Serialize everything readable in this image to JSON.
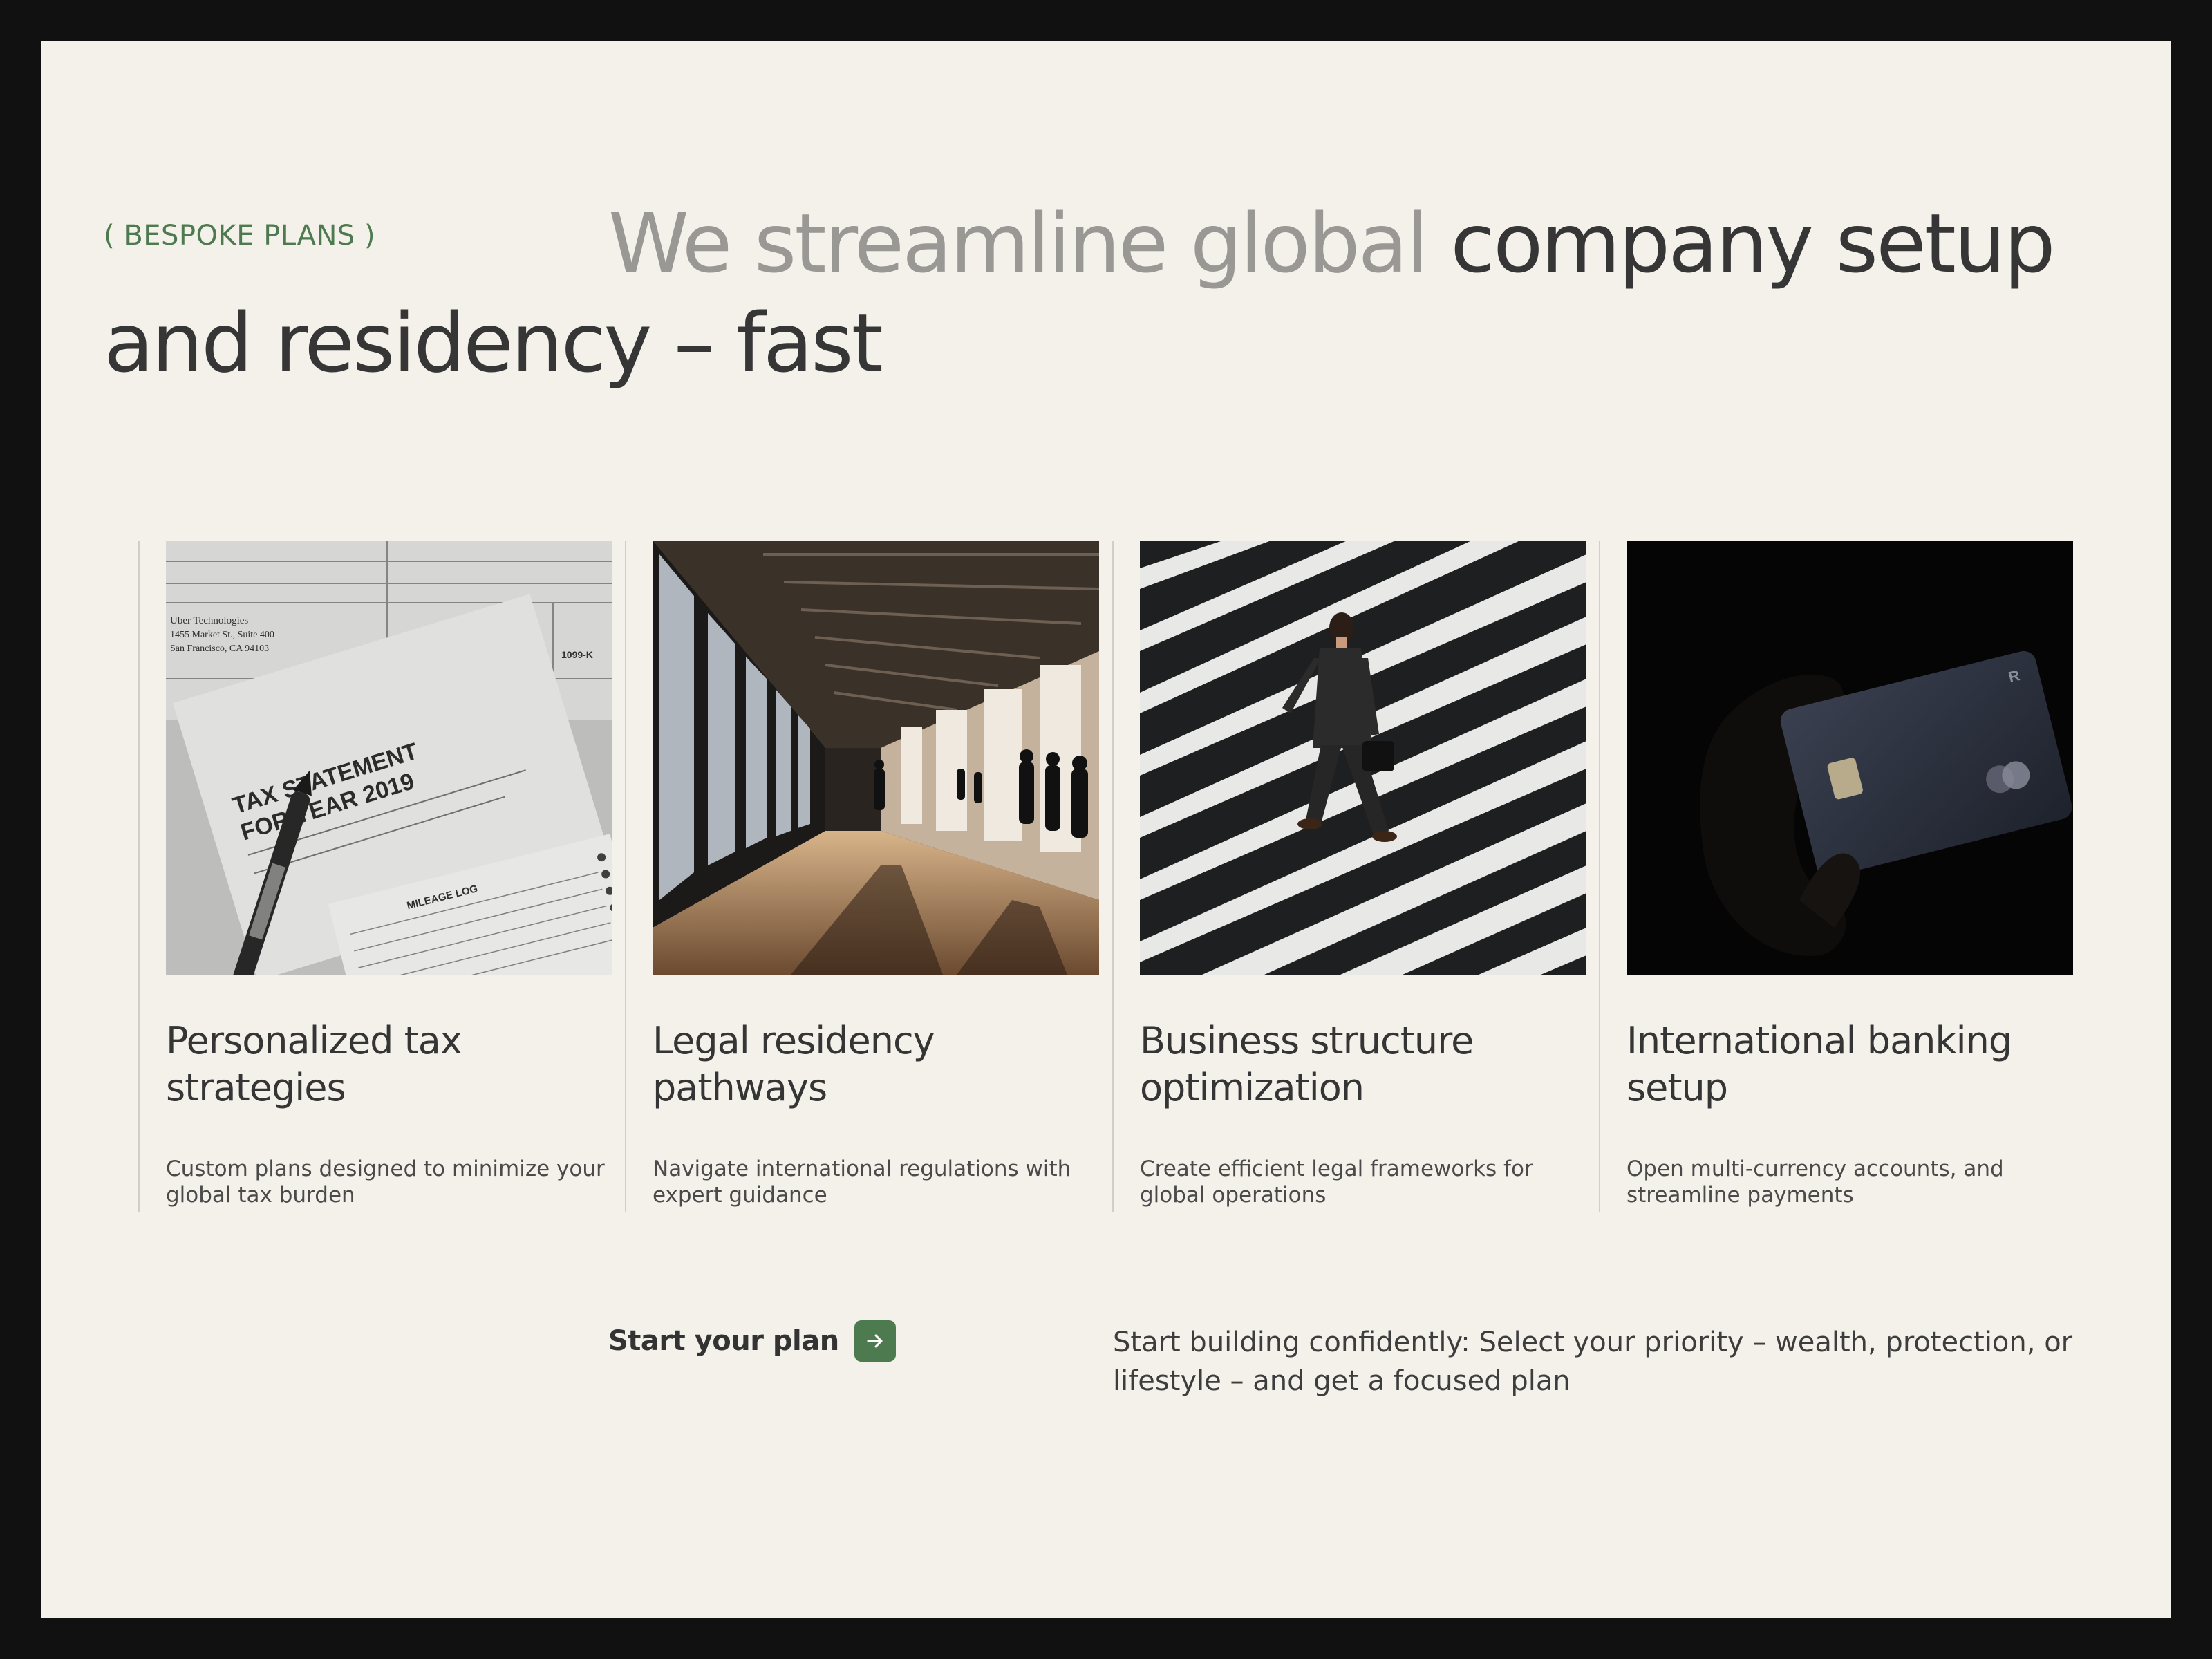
{
  "hero": {
    "eyebrow": "( BESPOKE PLANS )",
    "headline_muted": "We streamline global",
    "headline_strong": "company setup and residency – fast"
  },
  "cards": [
    {
      "title": "Personalized tax strategies",
      "description": "Custom plans designed to minimize your global tax burden",
      "image": "tax-documents-photo"
    },
    {
      "title": "Legal residency pathways",
      "description": "Navigate international regulations with expert guidance",
      "image": "airport-terminal-photo"
    },
    {
      "title": "Business structure optimization",
      "description": "Create efficient legal frameworks for global operations",
      "image": "crosswalk-businessman-photo"
    },
    {
      "title": "International banking setup",
      "description": "Open multi-currency accounts,  and streamline payments",
      "image": "bank-card-photo"
    }
  ],
  "tax_photo_text": {
    "statement_title": "TAX STATEMENT",
    "statement_year": "FOR YEAR 2019",
    "company": "Uber Technologies",
    "address_1": "1455 Market St., Suite 400",
    "address_2": "San Francisco, CA  94103",
    "log_title": "MILEAGE LOG",
    "form": "1099-K"
  },
  "cta": {
    "label": "Start your plan",
    "icon": "arrow-right-icon",
    "note": "Start building confidently: Select your priority – wealth, protection, or lifestyle – and get a focused plan"
  },
  "colors": {
    "accent": "#4e7a4f",
    "background": "#f4f0ea",
    "frame": "#111111",
    "text": "#333333",
    "muted": "#9a9895"
  }
}
